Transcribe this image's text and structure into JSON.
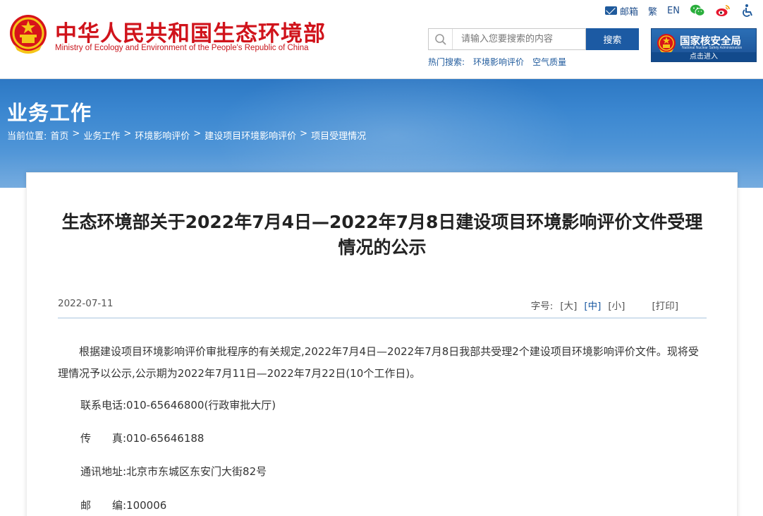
{
  "header": {
    "title": "中华人民共和国生态环境部",
    "subtitle": "Ministry of Ecology and Environment of the People's Republic of China",
    "top_links": {
      "mail": "邮箱",
      "traditional": "繁",
      "english": "EN"
    },
    "search": {
      "placeholder": "请输入您要搜索的内容",
      "button": "搜索"
    },
    "hot_search": {
      "label": "热门搜索:",
      "items": [
        "环境影响评价",
        "空气质量"
      ]
    },
    "nsa": {
      "name": "国家核安全局",
      "english": "National Nuclear Safety Administration",
      "enter": "点击进入"
    }
  },
  "banner": {
    "section": "业务工作",
    "breadcrumb_label": "当前位置:",
    "breadcrumb": [
      "首页",
      "业务工作",
      "环境影响评价",
      "建设项目环境影响评价",
      "项目受理情况"
    ],
    "separator": ">"
  },
  "article": {
    "title": "生态环境部关于2022年7月4日—2022年7月8日建设项目环境影响评价文件受理情况的公示",
    "date": "2022-07-11",
    "font_label": "字号:",
    "font_sizes": [
      "[大]",
      "[中]",
      "[小]"
    ],
    "print": "[打印]",
    "paragraph": "根据建设项目环境影响评价审批程序的有关规定,2022年7月4日—2022年7月8日我部共受理2个建设项目环境影响评价文件。现将受理情况予以公示,公示期为2022年7月11日—2022年7月22日(10个工作日)。",
    "contacts": [
      "联系电话:010-65646800(行政审批大厅)",
      "传　　真:010-65646188",
      "通讯地址:北京市东城区东安门大街82号",
      "邮　　编:100006"
    ]
  },
  "colors": {
    "brand_red": "#d0131b",
    "link_blue": "#1c5aa3",
    "banner_blue": "#3b87d0"
  }
}
